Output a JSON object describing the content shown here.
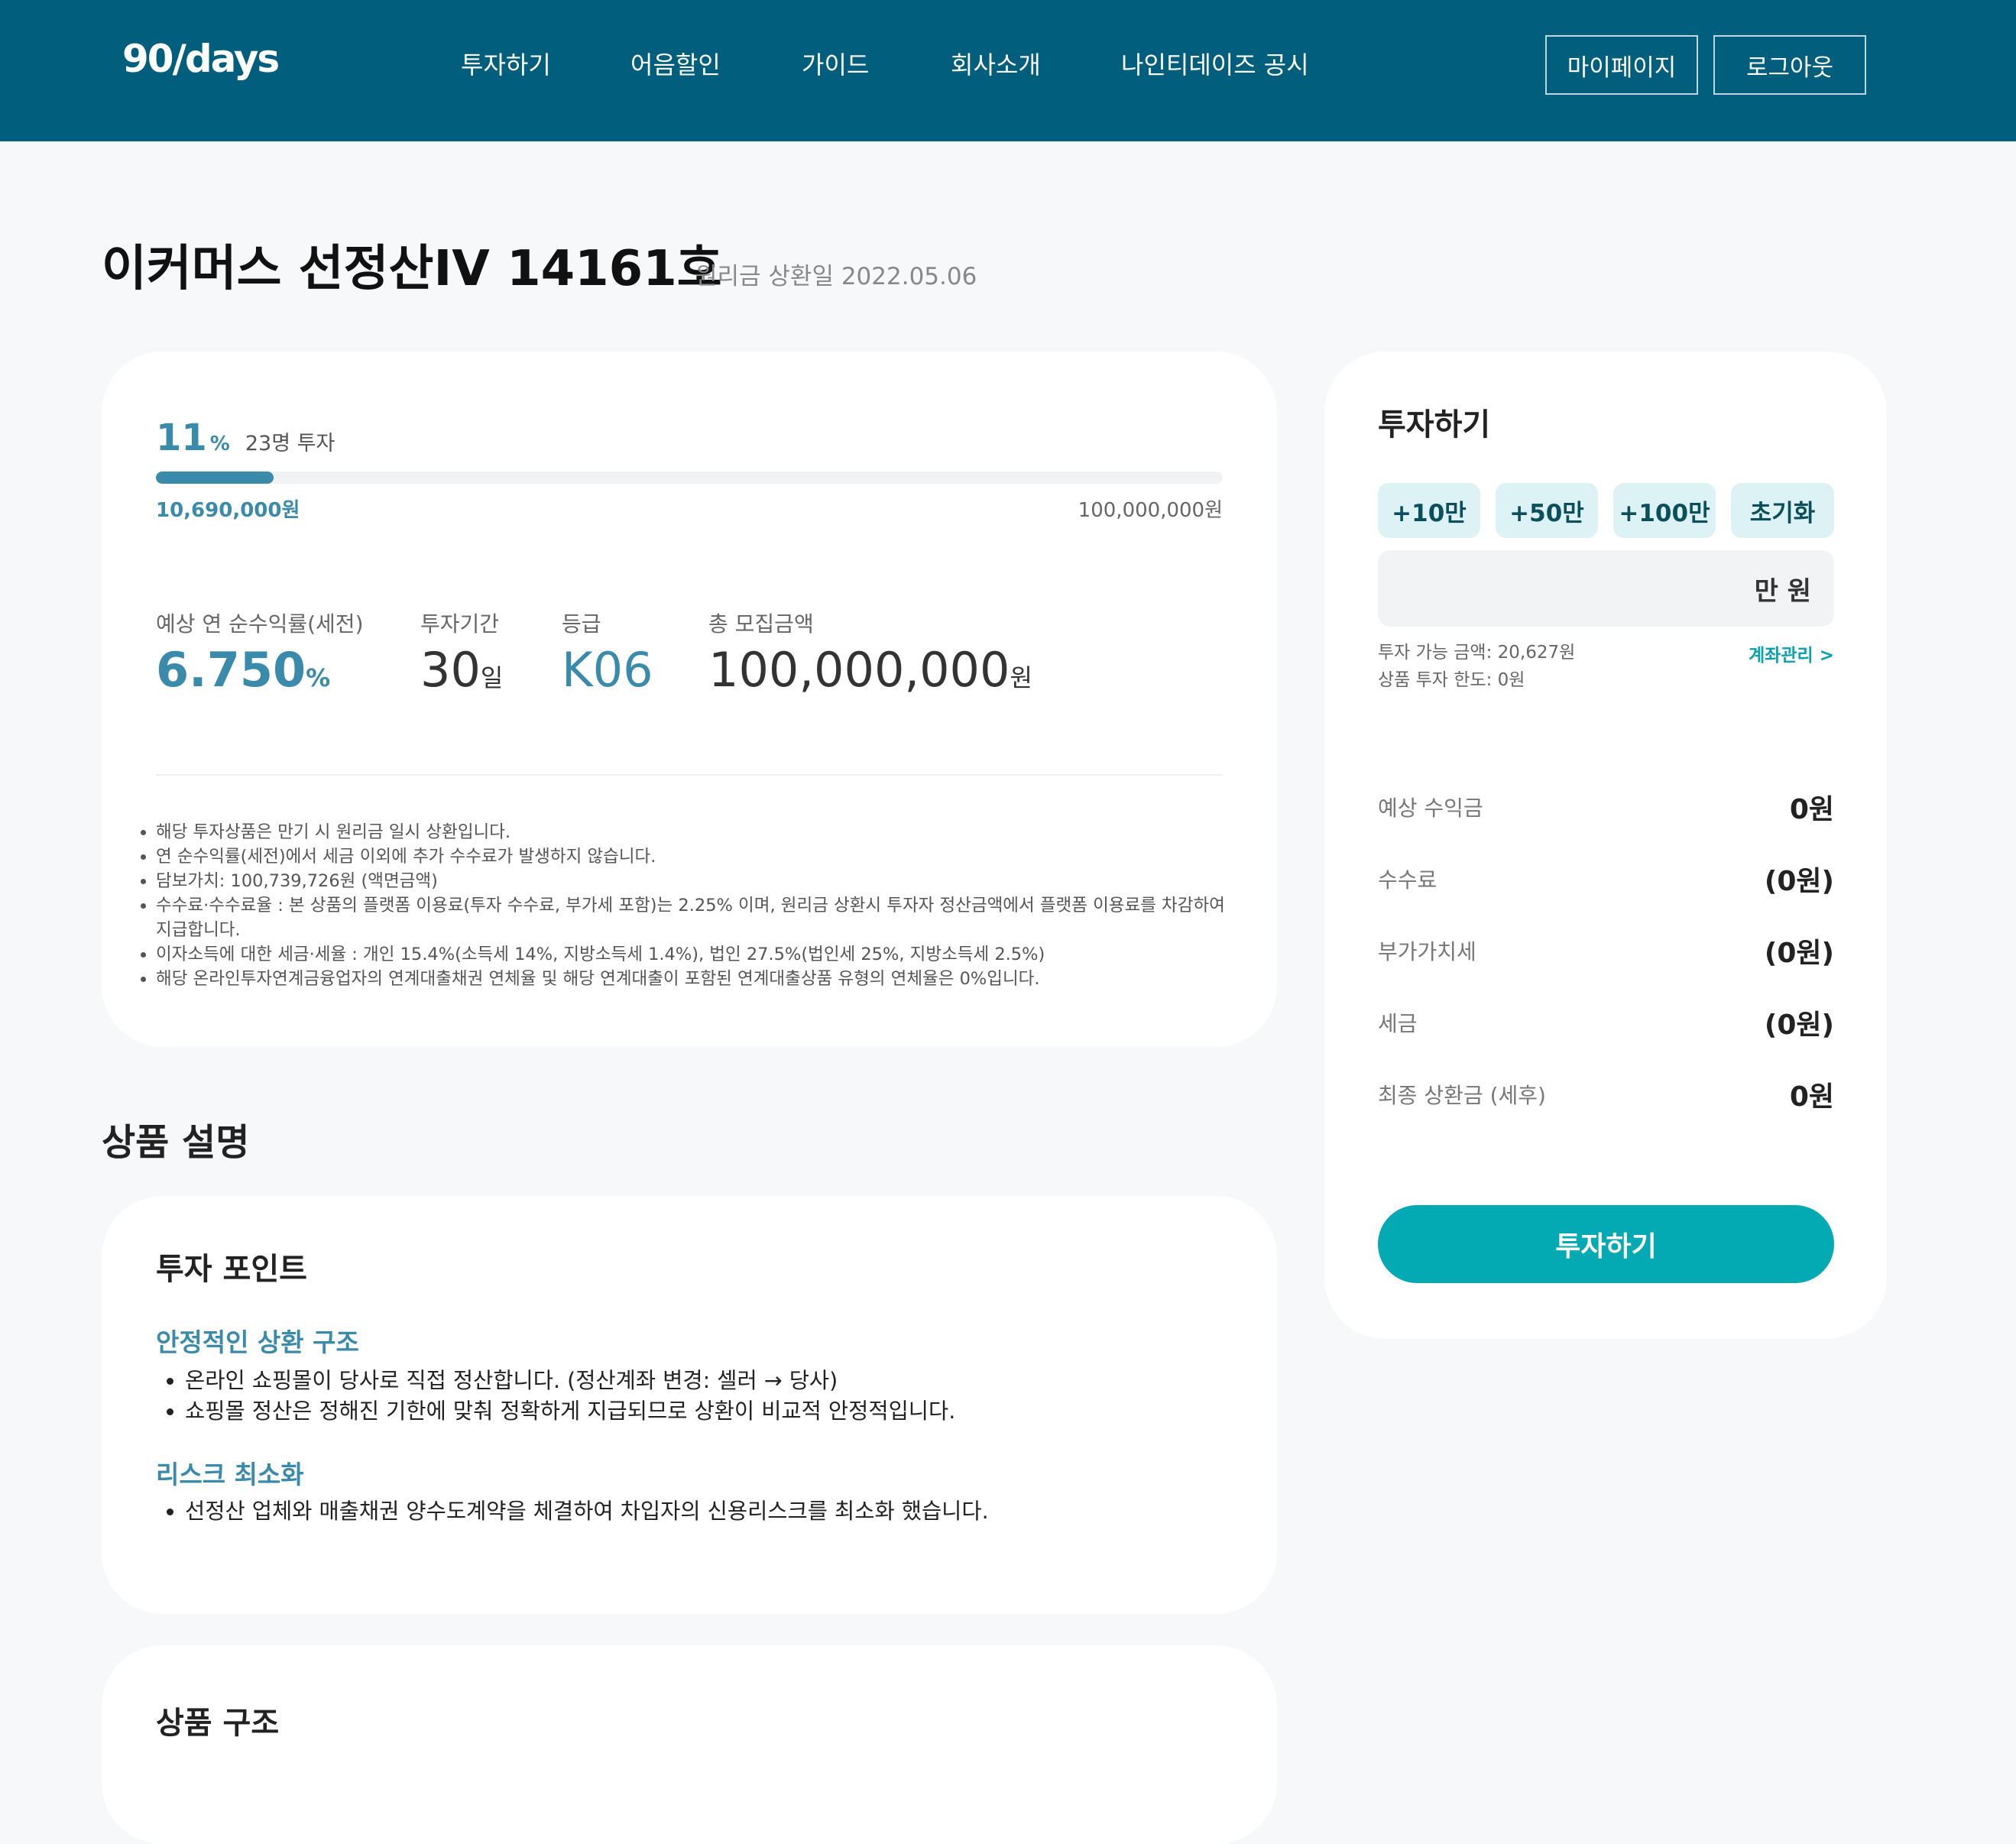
{
  "header": {
    "logo": "90/days",
    "nav": [
      "투자하기",
      "어음할인",
      "가이드",
      "회사소개",
      "나인티데이즈 공시"
    ],
    "mypage": "마이페이지",
    "logout": "로그아웃"
  },
  "product": {
    "title": "이커머스 선정산IV 14161호",
    "repay_date": "원리금 상환일 2022.05.06",
    "progress": {
      "percent": "11",
      "percent_unit": "%",
      "percent_value": 0.11,
      "investors": "23명 투자",
      "raised": "10,690,000원",
      "target": "100,000,000원"
    },
    "stats": [
      {
        "label": "예상 연 순수익률(세전)",
        "value": "6.750",
        "unit": "%"
      },
      {
        "label": "투자기간",
        "value": "30",
        "unit": "일"
      },
      {
        "label": "등급",
        "value": "K06",
        "unit": ""
      },
      {
        "label": "총 모집금액",
        "value": "100,000,000",
        "unit": "원"
      }
    ],
    "notes": [
      "해당 투자상품은 만기 시 원리금 일시 상환입니다.",
      "연 순수익률(세전)에서 세금 이외에 추가 수수료가 발생하지 않습니다.",
      "담보가치: 100,739,726원 (액면금액)",
      "수수료·수수료율 : 본 상품의 플랫폼 이용료(투자 수수료, 부가세 포함)는 2.25% 이며, 원리금 상환시 투자자 정산금액에서 플랫폼 이용료를 차감하여 지급합니다.",
      "이자소득에 대한 세금·세율 : 개인 15.4%(소득세 14%, 지방소득세 1.4%), 법인 27.5%(법인세 25%, 지방소득세 2.5%)",
      "해당 온라인투자연계금융업자의 연계대출채권 연체율 및 해당 연계대출이 포함된 연계대출상품 유형의 연체율은 0%입니다."
    ]
  },
  "description": {
    "section_title": "상품 설명",
    "point_title": "투자 포인트",
    "sub1": "안정적인 상환 구조",
    "sub1_items": [
      "온라인 쇼핑몰이 당사로 직접 정산합니다. (정산계좌 변경: 셀러 → 당사)",
      "쇼핑몰 정산은 정해진 기한에 맞춰 정확하게 지급되므로 상환이 비교적 안정적입니다."
    ],
    "sub2": "리스크 최소화",
    "sub2_items": [
      "선정산 업체와 매출채권 양수도계약을 체결하여 차입자의 신용리스크를 최소화 했습니다."
    ],
    "structure_title": "상품 구조"
  },
  "invest_panel": {
    "title": "투자하기",
    "quick": [
      "+10만",
      "+50만",
      "+100만",
      "초기화"
    ],
    "amount_value": "",
    "amount_unit": "만 원",
    "available": "투자 가능 금액: 20,627원",
    "limit": "상품 투자 한도: 0원",
    "account_link": "계좌관리 >",
    "rows": [
      {
        "label": "예상 수익금",
        "value": "0원"
      },
      {
        "label": "수수료",
        "value": "(0원)"
      },
      {
        "label": "부가가치세",
        "value": "(0원)"
      },
      {
        "label": "세금",
        "value": "(0원)"
      },
      {
        "label": "최종 상환금 (세후)",
        "value": "0원"
      }
    ],
    "submit": "투자하기"
  },
  "colors": {
    "header_bg": "#025e7d",
    "accent": "#3a8bab",
    "button": "#03aab3",
    "quick_bg": "#dcf2f4"
  }
}
